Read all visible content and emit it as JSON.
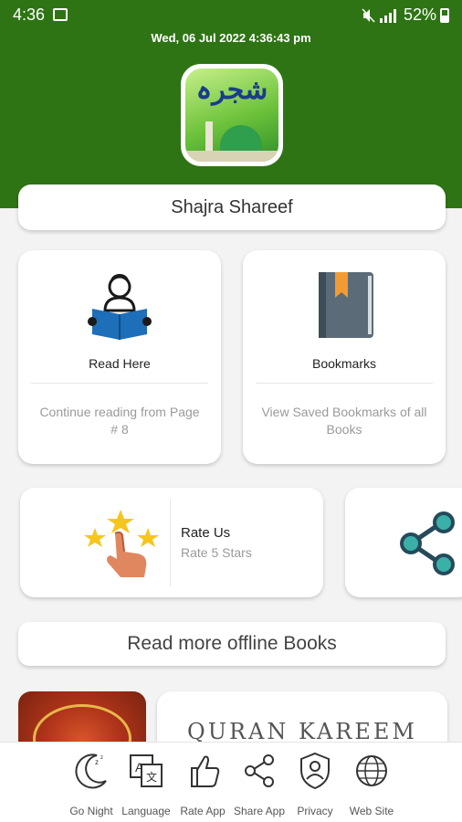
{
  "status_bar": {
    "time": "4:36",
    "battery": "52%"
  },
  "datetime": "Wed, 06  Jul  2022   4:36:43 pm",
  "app": {
    "logo_text": "شجرہ",
    "title": "Shajra Shareef"
  },
  "features": [
    {
      "name": "Read Here",
      "desc": "Continue reading from Page # 8",
      "icon": "reading-person-icon"
    },
    {
      "name": "Bookmarks",
      "desc": "View Saved Bookmarks of all Books",
      "icon": "bookmark-book-icon"
    }
  ],
  "rate": {
    "name": "Rate Us",
    "desc": "Rate 5 Stars",
    "icon": "rating-stars-hand-icon"
  },
  "share": {
    "icon": "share-icon"
  },
  "section_title": "Read more offline Books",
  "books": [
    {
      "title": "",
      "icon": "quran-cover-icon"
    },
    {
      "title": "QURAN  KAREEM"
    }
  ],
  "bottom_nav": [
    {
      "label": "Go Night",
      "icon": "moon-icon"
    },
    {
      "label": "Language",
      "icon": "translate-icon"
    },
    {
      "label": "Rate App",
      "icon": "thumbs-up-icon"
    },
    {
      "label": "Share App",
      "icon": "share-icon"
    },
    {
      "label": "Privacy",
      "icon": "shield-user-icon"
    },
    {
      "label": "Web Site",
      "icon": "globe-icon"
    }
  ],
  "colors": {
    "header": "#2e7414",
    "accent_blue": "#1c6fb8",
    "book_gray": "#5b6b78",
    "bookmark_orange": "#f29b33"
  }
}
